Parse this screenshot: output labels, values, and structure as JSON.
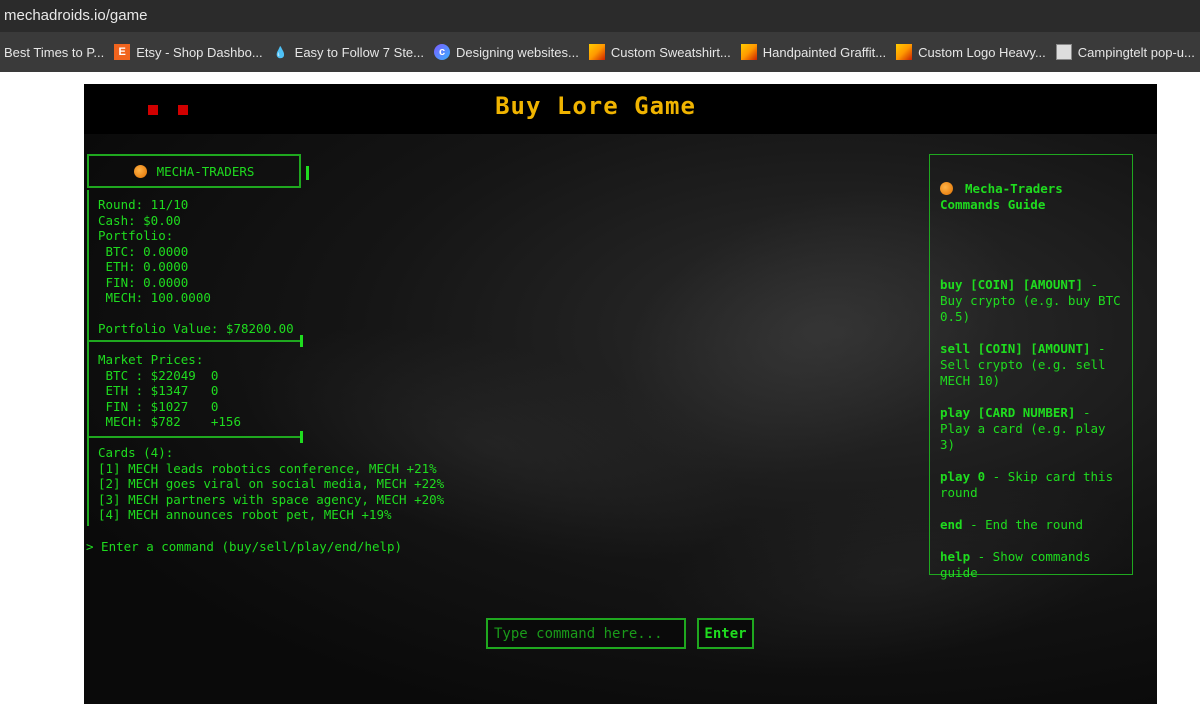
{
  "browser": {
    "url": "mechadroids.io/game",
    "bookmarks": [
      {
        "label": "Best Times to P...",
        "icon": "none"
      },
      {
        "label": "Etsy - Shop Dashbo...",
        "icon": "etsy-icon"
      },
      {
        "label": "Easy to Follow 7 Ste...",
        "icon": "water-drop-icon"
      },
      {
        "label": "Designing websites...",
        "icon": "c-logo-icon"
      },
      {
        "label": "Custom Sweatshirt...",
        "icon": "graffiti-icon"
      },
      {
        "label": "Handpainted Graffit...",
        "icon": "graffiti-icon"
      },
      {
        "label": "Custom Logo Heavy...",
        "icon": "graffiti-icon"
      },
      {
        "label": "Campingtelt pop-u...",
        "icon": "page-icon"
      }
    ]
  },
  "game": {
    "title": "Buy Lore Game",
    "colors": {
      "accent": "#1fdc1f",
      "border": "#1fa81f",
      "title": "#f0b400",
      "dots": "#d10000"
    }
  },
  "status": {
    "header": "MECHA-TRADERS",
    "round": "Round: 11/10",
    "cash": "Cash: $0.00",
    "portfolio_label": "Portfolio:",
    "holdings": [
      " BTC: 0.0000",
      " ETH: 0.0000",
      " FIN: 0.0000",
      " MECH: 100.0000"
    ],
    "portfolio_value": "Portfolio Value: $78200.00"
  },
  "market": {
    "label": "Market Prices:",
    "rows": [
      " BTC : $22049  0",
      " ETH : $1347   0",
      " FIN : $1027   0",
      " MECH: $782    +156"
    ]
  },
  "cards": {
    "label": "Cards (4):",
    "items": [
      "[1] MECH leads robotics conference, MECH +21%",
      "[2] MECH goes viral on social media, MECH +22%",
      "[3] MECH partners with space agency, MECH +20%",
      "[4] MECH announces robot pet, MECH +19%"
    ]
  },
  "prompt": "> Enter a command (buy/sell/play/end/help)",
  "guide": {
    "title_line1": "Mecha-Traders",
    "title_line2": "Commands Guide",
    "items": [
      {
        "cmd": "buy [COIN] [AMOUNT]",
        "desc": " - Buy crypto (e.g. buy BTC 0.5)"
      },
      {
        "cmd": "sell [COIN] [AMOUNT]",
        "desc": " - Sell crypto (e.g. sell MECH 10)"
      },
      {
        "cmd": "play [CARD NUMBER]",
        "desc": " - Play a card (e.g. play 3)"
      },
      {
        "cmd": "play 0",
        "desc": " - Skip card this round"
      },
      {
        "cmd": "end",
        "desc": " - End the round"
      },
      {
        "cmd": "help",
        "desc": " - Show commands guide"
      }
    ]
  },
  "command": {
    "placeholder": "Type command here...",
    "value": "",
    "button_label": "Enter"
  }
}
